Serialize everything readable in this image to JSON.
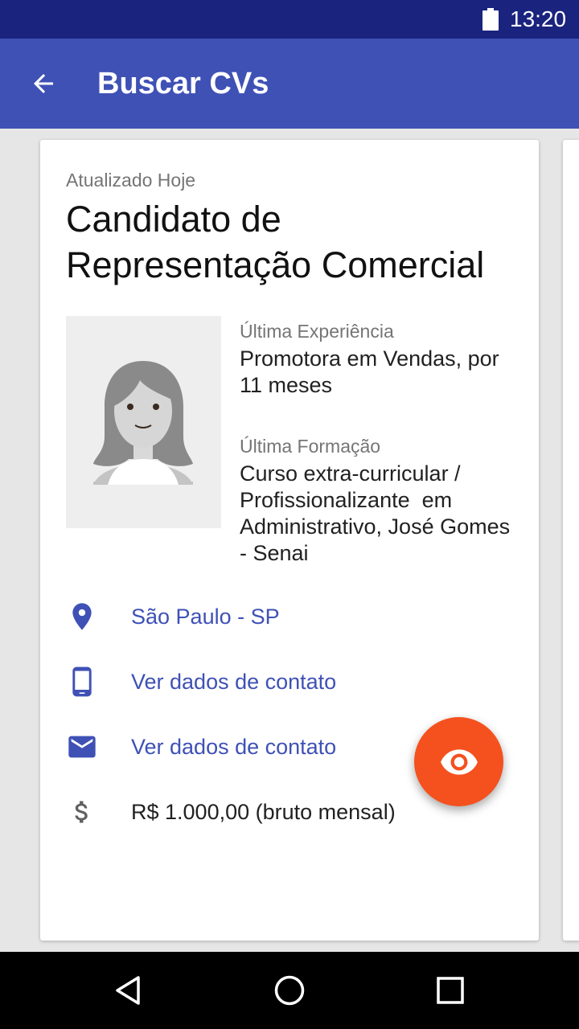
{
  "status_bar": {
    "time": "13:20",
    "battery_icon": "battery-full-icon"
  },
  "app_bar": {
    "back_icon": "arrow-back-icon",
    "title": "Buscar CVs",
    "color": "#3f51b5"
  },
  "card": {
    "updated_label": "Atualizado Hoje",
    "title": "Candidato de Representação Comercial",
    "photo_icon": "female-avatar-placeholder",
    "last_experience": {
      "label": "Última Experiência",
      "value": "Promotora em Vendas, por 11 meses"
    },
    "last_education": {
      "label": "Última Formação",
      "value": "Curso extra-curricular / Profissionalizante  em Administrativo, José Gomes - Senai"
    },
    "details": [
      {
        "icon": "location-pin-icon",
        "text": "São Paulo - SP"
      },
      {
        "icon": "phone-icon",
        "text": "Ver dados de contato"
      },
      {
        "icon": "email-icon",
        "text": "Ver dados de contato"
      },
      {
        "icon": "dollar-icon",
        "text": "R$ 1.000,00 (bruto mensal)"
      }
    ]
  },
  "fab": {
    "icon": "eye-icon",
    "color": "#f4511e"
  },
  "nav_bar": {
    "back_icon": "nav-back-triangle-icon",
    "home_icon": "nav-home-circle-icon",
    "recents_icon": "nav-recents-square-icon"
  },
  "colors": {
    "status_bar": "#1a237e",
    "primary": "#3f51b5",
    "accent": "#f4511e"
  }
}
